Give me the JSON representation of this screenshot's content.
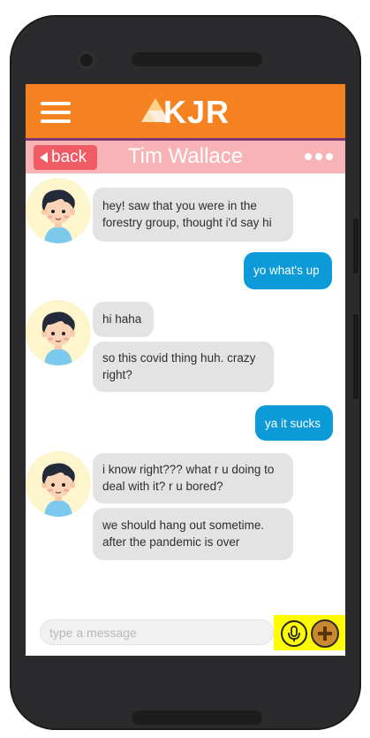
{
  "header": {
    "logo_text": "KJR"
  },
  "subbar": {
    "back_label": "back",
    "contact_name": "Tim Wallace"
  },
  "messages": [
    {
      "sender": "them",
      "lines": [
        "hey! saw that you were in the",
        "forestry group, thought i'd say hi"
      ]
    },
    {
      "sender": "me",
      "lines": [
        "yo what's up"
      ]
    },
    {
      "sender": "them",
      "lines": [
        "hi haha"
      ]
    },
    {
      "sender": "them",
      "lines": [
        "so this covid thing huh. crazy",
        "right?"
      ]
    },
    {
      "sender": "me",
      "lines": [
        "ya it sucks"
      ]
    },
    {
      "sender": "them",
      "lines": [
        "i know right??? what r u doing to",
        "deal with it? r u bored?"
      ]
    },
    {
      "sender": "them",
      "lines": [
        "we should hang out sometime.",
        "after the pandemic is over"
      ]
    }
  ],
  "composer": {
    "placeholder": "type a message"
  },
  "icons": {
    "menu": "hamburger-icon",
    "back": "back-arrow-icon",
    "more": "more-dots-icon",
    "mic": "microphone-icon",
    "add": "plus-icon",
    "avatar": "boy-avatar"
  },
  "colors": {
    "header": "#f58220",
    "subbar": "#f7b3b6",
    "back_button": "#f15b63",
    "outgoing_bubble": "#0c9ad8",
    "incoming_bubble": "#e3e3e3",
    "highlight": "#fffb00"
  }
}
